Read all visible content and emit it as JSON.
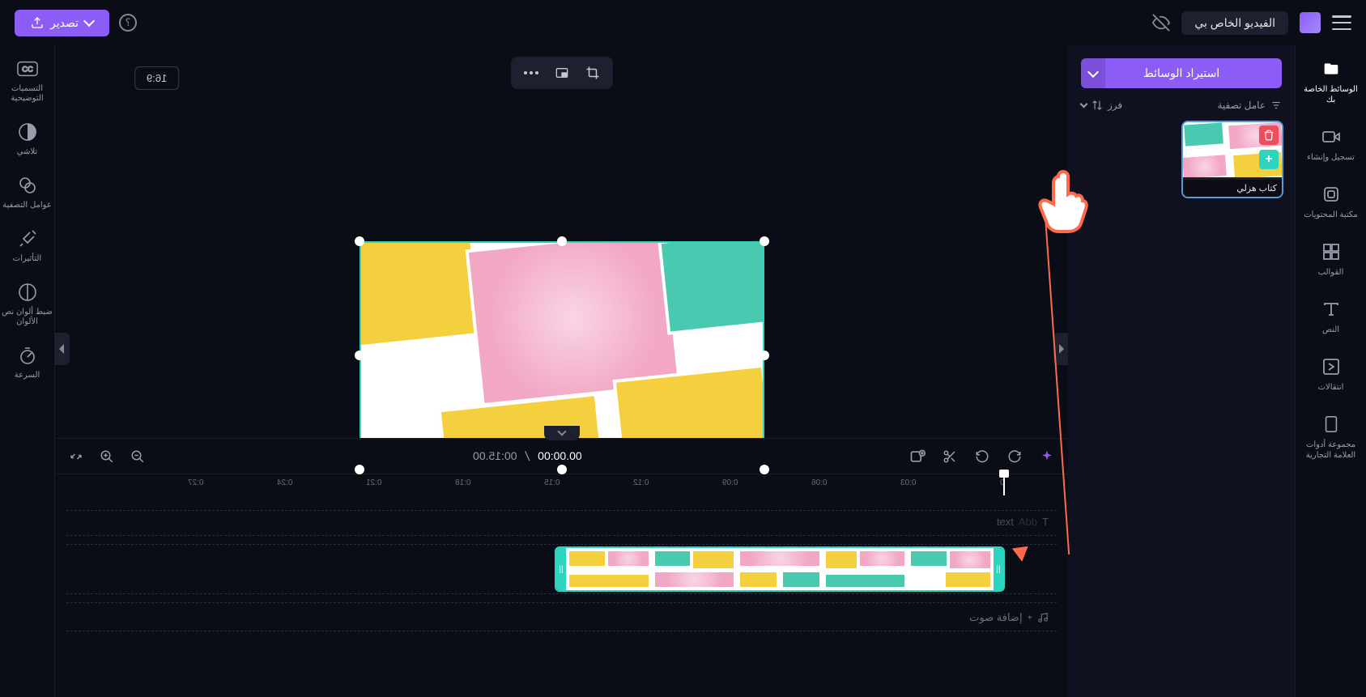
{
  "header": {
    "project_title": "الفيديو الخاص بي",
    "export_label": "تصدير"
  },
  "sidebar": {
    "items": [
      {
        "label": "الوسائط الخاصة بك",
        "icon": "folder"
      },
      {
        "label": "تسجيل وإنشاء",
        "icon": "record"
      },
      {
        "label": "مكتبة المحتويات",
        "icon": "library"
      },
      {
        "label": "القوالب",
        "icon": "templates"
      },
      {
        "label": "النص",
        "icon": "text"
      },
      {
        "label": "انتقالات",
        "icon": "transitions"
      },
      {
        "label": "مجموعة أدوات العلامة التجارية",
        "icon": "brand"
      }
    ]
  },
  "media_panel": {
    "import_label": "استيراد الوسائط",
    "filter_label": "عامل تصفية",
    "sort_label": "فرز",
    "items": [
      {
        "label": "كتاب هزلي"
      }
    ]
  },
  "preview": {
    "aspect_ratio": "16:9"
  },
  "playback": {
    "current_time": "00:00.00",
    "total_time": "00:15.00"
  },
  "timeline": {
    "ticks": [
      "0",
      "0:03",
      "0:06",
      "0:09",
      "0:12",
      "0:15",
      "0:18",
      "0:21",
      "0:24",
      "0:27"
    ],
    "text_placeholder": "text",
    "audio_placeholder": "إضافة صوت"
  },
  "props": {
    "items": [
      {
        "label": "التسميات التوضيحية"
      },
      {
        "label": "تلاشي"
      },
      {
        "label": "عوامل التصفية"
      },
      {
        "label": "التأثيرات"
      },
      {
        "label": "ضبط ألوان نص الألوان"
      },
      {
        "label": "السرعة"
      }
    ]
  }
}
